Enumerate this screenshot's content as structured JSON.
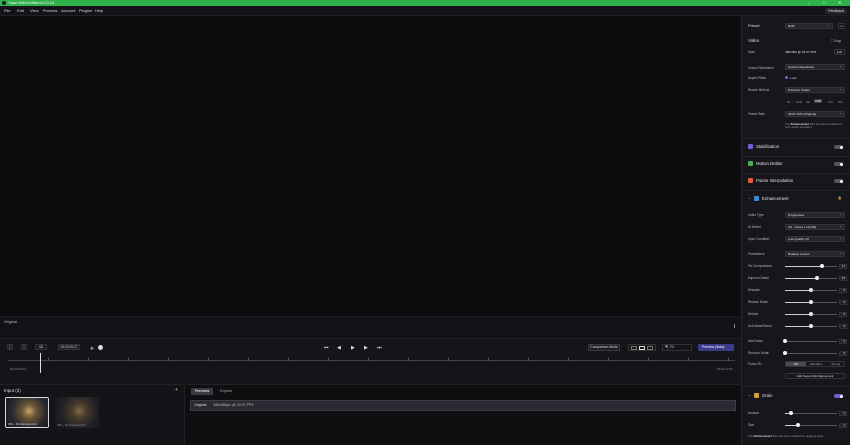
{
  "titlebar": {
    "title": "Topaz Video AI Beta v4.1.0.1.b",
    "minimize": "–",
    "maximize": "□",
    "close": "✕"
  },
  "menu": {
    "items": [
      "File",
      "Edit",
      "View",
      "Process",
      "Account",
      "Plugins",
      "Help"
    ],
    "feedback": "Feedback"
  },
  "viewer": {
    "label": "Original"
  },
  "transport": {
    "in": "[",
    "out": "]",
    "time": "00:00:05;27",
    "compare": "Comparison Mode",
    "zoom": "Fit",
    "preview": "Preview (3sec)",
    "t_start": "00:00:00:00",
    "t_end": "00:00:12:02"
  },
  "inputs": {
    "title": "Input (2)",
    "add": "+",
    "files": [
      "IMG - SimCamera.mp4",
      "IMG - SimCamera.mp4"
    ]
  },
  "details": {
    "tabs": [
      "Previews",
      "Exports"
    ],
    "row_label": "Original",
    "row_res": "480x360px @ 29.97 FPS"
  },
  "panel": {
    "preset_label": "Preset",
    "preset_value": "RCB",
    "video_title": "Video",
    "crop": "Crop",
    "input_label": "Input",
    "input_value": "480x360 @ 29.97 FPS",
    "edit": "Edit",
    "output_res_label": "Output Resolution",
    "output_res": "Custom Resolution",
    "aspect_label": "Aspect Ratio",
    "aspect_value": "Lock",
    "resize_label": "Resize Method",
    "resize_value": "Prioritize Height",
    "dims": [
      "4K",
      "1440",
      "HD",
      "1080",
      "720",
      "360"
    ],
    "fr_label": "Frame Rate",
    "fr_value": "29.97 FPS (Original)",
    "fr_note_a": "The ",
    "fr_note_b": "Enhancement",
    "fr_note_c": " filter has been enabled for high quality upscaling.",
    "stab": "Stabilization",
    "motion": "Motion Deblur",
    "interp": "Frame Interpolation",
    "enh_title": "Enhancement",
    "vtype_label": "Video Type",
    "vtype": "Progressive",
    "ai_label": "AI Model",
    "ai_value": "Iris - Faces / LQ-MQ",
    "ic_label": "Input Condition",
    "ic_value": "Low Quality V2",
    "param_label": "Parameters",
    "param_value": "Relative to Auto",
    "sliders": [
      {
        "label": "Fix Compression",
        "value": "37",
        "pct": 0.72
      },
      {
        "label": "Improve Detail",
        "value": "24",
        "pct": 0.62
      },
      {
        "label": "Sharpen",
        "value": "0",
        "pct": 0.5
      },
      {
        "label": "Reduce Noise",
        "value": "0",
        "pct": 0.5
      },
      {
        "label": "Dehalo",
        "value": "0",
        "pct": 0.5
      },
      {
        "label": "Anti-Alias/Deblur",
        "value": "0",
        "pct": 0.5
      }
    ],
    "add_noise": {
      "label": "Add Noise",
      "value": "0",
      "pct": 0.0
    },
    "recover": {
      "label": "Recover Detail",
      "value": "0",
      "pct": 0.0
    },
    "focus_label": "Focus Fix",
    "focus": [
      "Off",
      "Standard",
      "Strong"
    ],
    "add_second": "Add Second Enhancement",
    "grain_title": "Grain",
    "amount": {
      "label": "Amount",
      "value": "2",
      "pct": 0.12
    },
    "size": {
      "label": "Size",
      "value": "2",
      "pct": 0.25
    },
    "bottom_note_a": "The ",
    "bottom_note_b": "Enhancement",
    "bottom_note_c": " filter has been enabled for applying grain."
  },
  "colors": {
    "titlebar": "#2fb24a",
    "accent": "#6c63d8",
    "preview": "#3b3b8a"
  }
}
